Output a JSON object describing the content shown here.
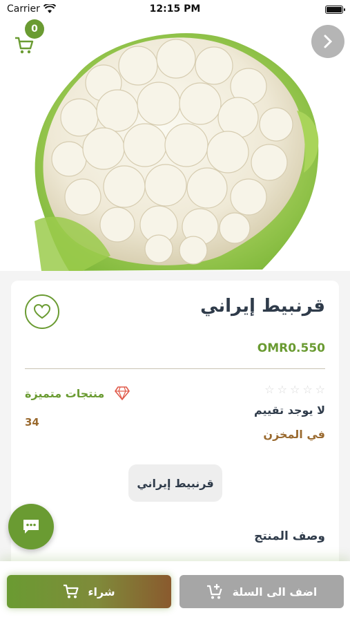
{
  "status_bar": {
    "carrier": "Carrier",
    "time": "12:15 PM"
  },
  "header": {
    "cart_count": "0"
  },
  "product": {
    "title": "قرنبيط إيراني",
    "price": "OMR0.550",
    "rating_text": "لا يوجد تقييم",
    "rating_stars": [
      "☆",
      "☆",
      "☆",
      "☆",
      "☆"
    ],
    "stock_label": "في المخزن",
    "stock_count": "34",
    "featured_label": "منتجات متميزة",
    "tag": "قرنبيط إيراني",
    "description_title": "وصف المنتج"
  },
  "actions": {
    "buy_label": "شراء",
    "add_to_cart_label": "اضف الى السلة"
  },
  "icons": {
    "cart": "cart-icon",
    "next": "chevron-right-icon",
    "heart": "heart-icon",
    "diamond": "diamond-icon",
    "chat": "chat-icon",
    "add_cart": "add-cart-icon",
    "buy": "cart-icon"
  },
  "colors": {
    "accent": "#6a9b32",
    "brown": "#9a6a2f",
    "text": "#2f3b4a",
    "disabled": "#a6a6a6"
  }
}
